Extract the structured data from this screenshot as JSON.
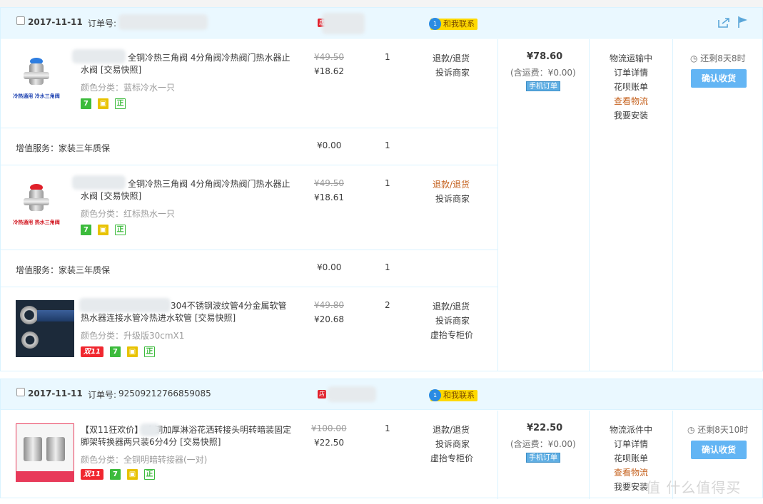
{
  "orders": [
    {
      "date": "2017-11-11",
      "order_no_label": "订单号:",
      "order_no": "",
      "contact_label": "和我联系",
      "items": [
        {
          "title": "全铜冷热三角阀 4分角阀冷热阀门热水器止水阀 [交易快照]",
          "sku": "颜色分类：蓝标冷水一只",
          "thumb_caption": "冷热通用 冷水三角阀",
          "orig_price": "¥49.50",
          "price": "¥18.62",
          "qty": "1",
          "ops": [
            "退款/退货",
            "投诉商家"
          ]
        },
        {
          "title": "全铜冷热三角阀 4分角阀冷热阀门热水器止水阀 [交易快照]",
          "sku": "颜色分类：红标热水一只",
          "thumb_caption": "冷热通用 热水三角阀",
          "orig_price": "¥49.50",
          "price": "¥18.61",
          "qty": "1",
          "ops": [
            "退款/退货",
            "投诉商家"
          ]
        },
        {
          "title": "304不锈钢波纹管4分金属软管热水器连接水管冷热进水软管 [交易快照]",
          "sku": "颜色分类：升级版30cmX1",
          "orig_price": "¥49.80",
          "price": "¥20.68",
          "qty": "2",
          "ops": [
            "退款/退货",
            "投诉商家",
            "虚抬专柜价"
          ]
        }
      ],
      "services": [
        {
          "label": "增值服务：家装三年质保",
          "price": "¥0.00",
          "qty": "1"
        },
        {
          "label": "增值服务：家装三年质保",
          "price": "¥0.00",
          "qty": "1"
        }
      ],
      "total": "¥78.60",
      "shipping": "(含运费：¥0.00)",
      "mobile_tag": "手机订单",
      "status": [
        "物流运输中",
        "订单详情",
        "花呗账单",
        "查看物流",
        "我要安装"
      ],
      "timer": "还剩8天8时",
      "confirm_label": "确认收货"
    },
    {
      "date": "2017-11-11",
      "order_no_label": "订单号:",
      "order_no": "92509212766859085",
      "contact_label": "和我联系",
      "items": [
        {
          "title": "【双11狂欢价】 全铜加厚淋浴花洒转接头明转暗装固定脚架转换器两只装6分4分 [交易快照]",
          "sku": "颜色分类：全铜明暗转接器(一对)",
          "orig_price": "¥100.00",
          "price": "¥22.50",
          "qty": "1",
          "ops": [
            "退款/退货",
            "投诉商家",
            "虚抬专柜价"
          ]
        }
      ],
      "total": "¥22.50",
      "shipping": "(含运费：¥0.00)",
      "mobile_tag": "手机订单",
      "status": [
        "物流派件中",
        "订单详情",
        "花呗账单",
        "查看物流",
        "我要安装"
      ],
      "timer": "还剩8天10时",
      "confirm_label": "确认收货"
    }
  ],
  "badges": {
    "seven": "7",
    "zheng": "正",
    "double11": "双11"
  },
  "watermark": "值 什么值得买",
  "colors": {
    "accent_blue": "#63b5f4",
    "header_bg": "#eaf8ff",
    "logistics_orange": "#c5611d",
    "contact_yellow": "#ffd900"
  }
}
